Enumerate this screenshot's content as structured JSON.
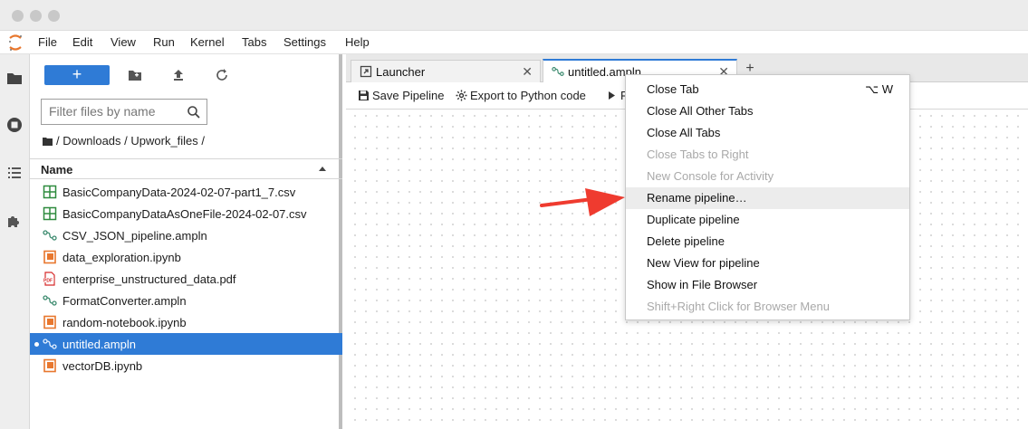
{
  "menubar": {
    "items": [
      "File",
      "Edit",
      "View",
      "Run",
      "Kernel",
      "Tabs",
      "Settings",
      "Help"
    ]
  },
  "filebrowser": {
    "new_label": "+",
    "filter_placeholder": "Filter files by name",
    "breadcrumb": "/ Downloads / Upwork_files /",
    "column_name": "Name",
    "files": [
      {
        "name": "BasicCompanyData-2024-02-07-part1_7.csv",
        "icon": "csv-icon"
      },
      {
        "name": "BasicCompanyDataAsOneFile-2024-02-07.csv",
        "icon": "csv-icon"
      },
      {
        "name": "CSV_JSON_pipeline.ampln",
        "icon": "pipeline-icon"
      },
      {
        "name": "data_exploration.ipynb",
        "icon": "notebook-icon"
      },
      {
        "name": "enterprise_unstructured_data.pdf",
        "icon": "pdf-icon"
      },
      {
        "name": "FormatConverter.ampln",
        "icon": "pipeline-icon"
      },
      {
        "name": "random-notebook.ipynb",
        "icon": "notebook-icon"
      },
      {
        "name": "untitled.ampln",
        "icon": "pipeline-icon",
        "selected": true
      },
      {
        "name": "vectorDB.ipynb",
        "icon": "notebook-icon"
      }
    ]
  },
  "tabs": [
    {
      "label": "Launcher",
      "icon": "launcher-icon"
    },
    {
      "label": "untitled.ampln",
      "icon": "pipeline-icon",
      "active": true
    }
  ],
  "toolbar": {
    "save_label": "Save Pipeline",
    "export_label": "Export to Python code",
    "run_label": "R"
  },
  "context_menu": {
    "items": [
      {
        "label": "Close Tab",
        "shortcut": "⌥ W"
      },
      {
        "label": "Close All Other Tabs"
      },
      {
        "label": "Close All Tabs"
      },
      {
        "label": "Close Tabs to Right",
        "disabled": true
      },
      {
        "label": "New Console for Activity",
        "disabled": true
      },
      {
        "label": "Rename pipeline…",
        "hover": true
      },
      {
        "label": "Duplicate pipeline"
      },
      {
        "label": "Delete pipeline"
      },
      {
        "label": "New View for pipeline"
      },
      {
        "label": "Show in File Browser"
      },
      {
        "label": "Shift+Right Click for Browser Menu",
        "disabled": true
      }
    ]
  },
  "colors": {
    "accent": "#2f7bd6",
    "csv": "#2e8b3e",
    "pipeline": "#3b8a6e",
    "notebook": "#e8772e",
    "pdf": "#d62b2b",
    "arrow": "#ef3b2f"
  }
}
